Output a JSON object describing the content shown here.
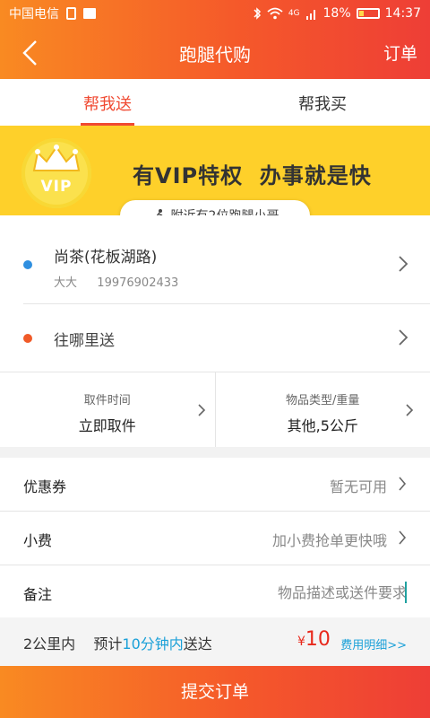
{
  "status_bar": {
    "carrier": "中国电信",
    "network": "4G",
    "battery": "18%",
    "time": "14:37"
  },
  "nav": {
    "title": "跑腿代购",
    "right_action": "订单"
  },
  "tabs": [
    {
      "label": "帮我送",
      "active": true
    },
    {
      "label": "帮我买",
      "active": false
    }
  ],
  "banner": {
    "badge_text": "VIP",
    "slogan": "有VIP特权  办事就是快",
    "nearby_text": "附近有2位跑腿小哥"
  },
  "pickup_address": {
    "name": "尚茶(花板湖路)",
    "contact": "大大",
    "phone": "19976902433"
  },
  "delivery_address": {
    "placeholder": "往哪里送"
  },
  "pickup_time": {
    "label": "取件时间",
    "value": "立即取件"
  },
  "item_type": {
    "label": "物品类型/重量",
    "value": "其他,5公斤"
  },
  "coupon": {
    "label": "优惠券",
    "value": "暂无可用"
  },
  "tip": {
    "label": "小费",
    "value": "加小费抢单更快哦"
  },
  "note": {
    "label": "备注",
    "placeholder": "物品描述或送件要求"
  },
  "summary": {
    "distance": "2公里内",
    "estimate_prefix": "预计",
    "estimate_time": "10分钟内",
    "estimate_suffix": "送达",
    "currency": "¥",
    "price": "10",
    "detail_link": "费用明细>>"
  },
  "submit_label": "提交订单",
  "colors": {
    "accent": "#f5592a",
    "banner": "#fed02a",
    "highlight": "#1aa0d8",
    "price": "#e8291c",
    "pickup_dot": "#2f8fe0",
    "delivery_dot": "#f05a28"
  }
}
